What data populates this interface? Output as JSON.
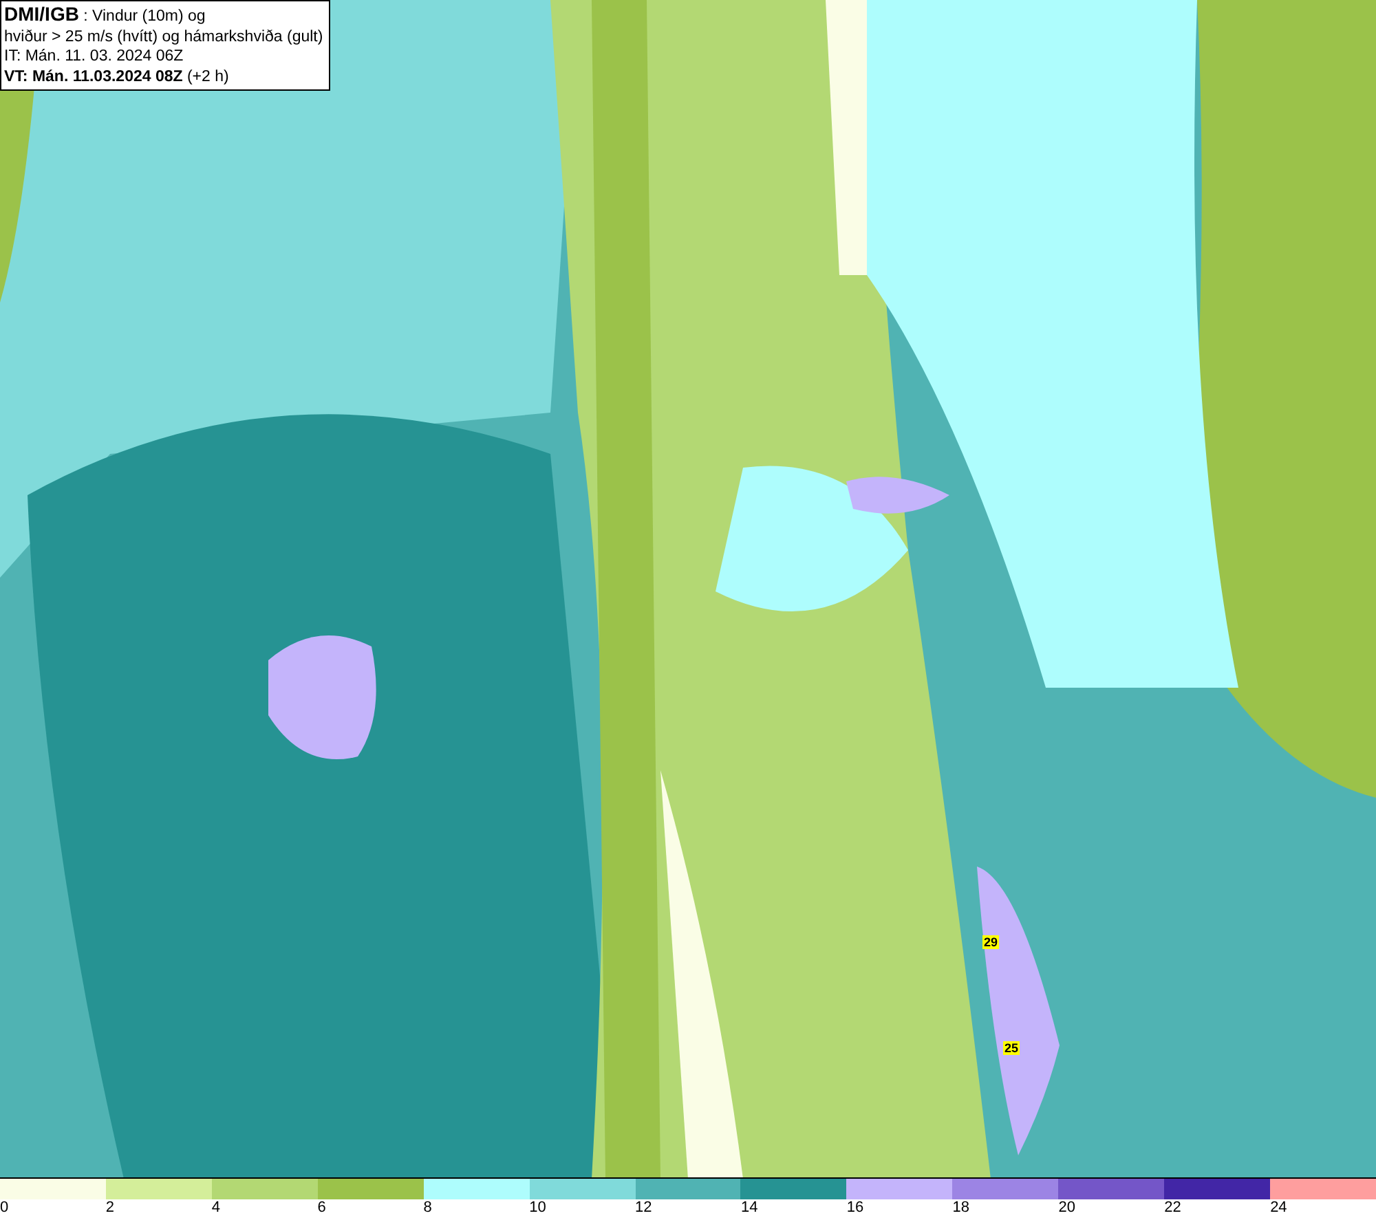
{
  "info_box": {
    "lines": [
      "**DMI/IGB** : Vindur (10m) og",
      "hviður > 25 m/s (hvítt) og hámarkshviða (gult)",
      "IT: Mán. 11. 03. 2024 06Z",
      "**VT: Mán. 11.03.2024 08Z** (+2 h)"
    ]
  },
  "gust_labels": [
    "29",
    "25"
  ],
  "legend": [
    {
      "label": "0",
      "color": "#fafde6"
    },
    {
      "label": "2",
      "color": "#d4ee9a"
    },
    {
      "label": "4",
      "color": "#b3d873"
    },
    {
      "label": "6",
      "color": "#9bc24a"
    },
    {
      "label": "8",
      "color": "#aefdfd"
    },
    {
      "label": "10",
      "color": "#80dada"
    },
    {
      "label": "12",
      "color": "#50b3b3"
    },
    {
      "label": "14",
      "color": "#269393"
    },
    {
      "label": "16",
      "color": "#c4b4fb"
    },
    {
      "label": "18",
      "color": "#9c84e4"
    },
    {
      "label": "20",
      "color": "#7456c8"
    },
    {
      "label": "22",
      "color": "#4226a6"
    },
    {
      "label": "24",
      "color": "#fe9e9e"
    }
  ]
}
